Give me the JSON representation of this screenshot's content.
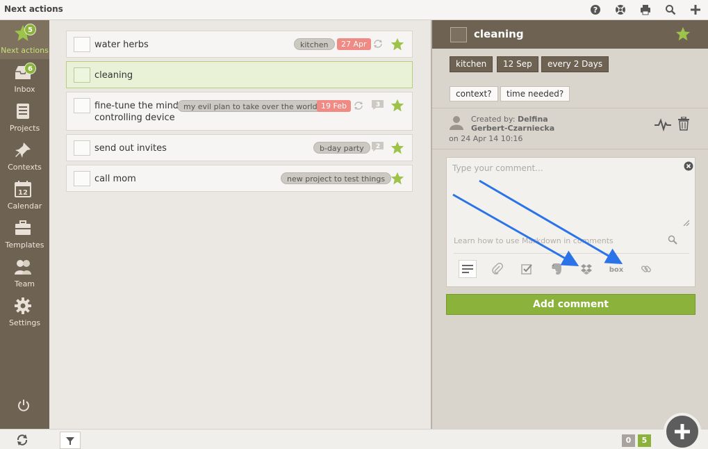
{
  "app": {
    "title": "Next actions"
  },
  "sidebar": {
    "items": [
      {
        "id": "next-actions",
        "label": "Next actions",
        "badge": "5",
        "icon": "star-icon"
      },
      {
        "id": "inbox",
        "label": "Inbox",
        "badge": "6",
        "icon": "inbox-icon"
      },
      {
        "id": "projects",
        "label": "Projects",
        "icon": "projects-icon"
      },
      {
        "id": "contexts",
        "label": "Contexts",
        "icon": "pin-icon"
      },
      {
        "id": "calendar",
        "label": "Calendar",
        "icon": "calendar-icon",
        "icon_text": "12"
      },
      {
        "id": "templates",
        "label": "Templates",
        "icon": "briefcase-icon"
      },
      {
        "id": "team",
        "label": "Team",
        "icon": "team-icon"
      },
      {
        "id": "settings",
        "label": "Settings",
        "icon": "gear-icon"
      }
    ]
  },
  "tasks": [
    {
      "name": "water herbs",
      "tag": "kitchen",
      "date": "27 Apr",
      "repeat": true,
      "starred": true
    },
    {
      "name": "cleaning",
      "selected": true
    },
    {
      "name_line1": "fine-tune the mind",
      "name_line2": "controlling device",
      "tag": "my evil plan to take over the world",
      "date": "19 Feb",
      "repeat": true,
      "comments": "3",
      "starred": true
    },
    {
      "name": "send out invites",
      "tag": "b-day party",
      "comments": "2",
      "starred": true
    },
    {
      "name": "call mom",
      "tag": "new project to test things",
      "starred": true
    }
  ],
  "detail": {
    "title": "cleaning",
    "tags": [
      "kitchen",
      "12 Sep",
      "every 2 Days"
    ],
    "buttons": [
      "context?",
      "time needed?"
    ],
    "created_label": "Created by:",
    "created_by": "Delfina Gerbert-Czarniecka",
    "created_on": "on 24 Apr 14 10:16",
    "comment_placeholder": "Type your comment...",
    "markdown_hint": "Learn how to use Markdown in comments",
    "add_comment_label": "Add comment"
  },
  "bottom": {
    "count_left": "0",
    "count_right": "5"
  },
  "colors": {
    "accent": "#8bb23a",
    "sidebar": "#6e6253",
    "date_badge": "#ef8a84"
  }
}
